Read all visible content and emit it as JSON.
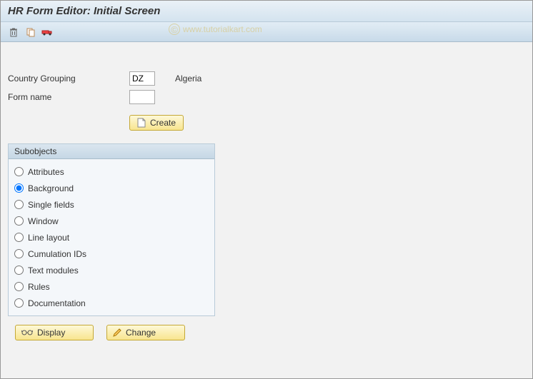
{
  "title": "HR Form Editor: Initial Screen",
  "toolbar": {
    "icon1": "delete-icon",
    "icon2": "copy-icon",
    "icon3": "transport-icon"
  },
  "fields": {
    "country_label": "Country Grouping",
    "country_value": "DZ",
    "country_display": "Algeria",
    "formname_label": "Form name",
    "formname_value": ""
  },
  "buttons": {
    "create": "Create",
    "display": "Display",
    "change": "Change"
  },
  "subobjects": {
    "title": "Subobjects",
    "options": [
      {
        "label": "Attributes",
        "selected": false
      },
      {
        "label": "Background",
        "selected": true
      },
      {
        "label": "Single fields",
        "selected": false
      },
      {
        "label": "Window",
        "selected": false
      },
      {
        "label": "Line layout",
        "selected": false
      },
      {
        "label": "Cumulation IDs",
        "selected": false
      },
      {
        "label": "Text modules",
        "selected": false
      },
      {
        "label": "Rules",
        "selected": false
      },
      {
        "label": "Documentation",
        "selected": false
      }
    ]
  },
  "watermark": "www.tutorialkart.com"
}
